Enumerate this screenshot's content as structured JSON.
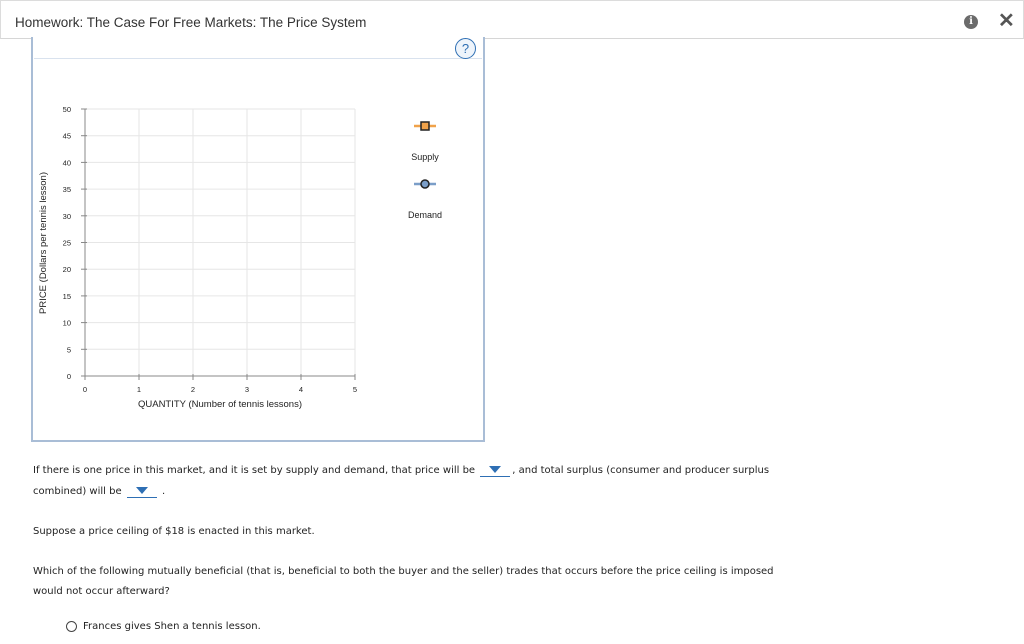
{
  "header": {
    "title": "Homework: The Case For Free Markets: The Price System",
    "info_icon": "i",
    "close_icon": "✕"
  },
  "help_icon": "?",
  "chart_data": {
    "type": "line",
    "xlabel": "QUANTITY (Number of tennis lessons)",
    "ylabel": "PRICE (Dollars per tennis lesson)",
    "x_ticks": [
      "0",
      "1",
      "2",
      "3",
      "4",
      "5"
    ],
    "y_ticks": [
      "0",
      "5",
      "10",
      "15",
      "20",
      "25",
      "30",
      "35",
      "40",
      "45",
      "50"
    ],
    "xlim": [
      0,
      5
    ],
    "ylim": [
      0,
      50
    ],
    "grid": true,
    "legend_placement": "right",
    "series": [
      {
        "name": "Supply",
        "color": "#f0a24a",
        "marker": "square",
        "values": []
      },
      {
        "name": "Demand",
        "color": "#7b9ec8",
        "marker": "circle",
        "values": []
      }
    ]
  },
  "questions": {
    "q1_part1": "If there is one price in this market, and it is set by supply and demand, that price will be",
    "q1_part2": ", and total surplus (consumer and producer surplus",
    "q1_part3": "combined) will be",
    "q1_part4": ".",
    "ceiling": "Suppose a price ceiling of $18 is enacted in this market.",
    "q2_line1": "Which of the following mutually beneficial (that is, beneficial to both the buyer and the seller) trades that occurs before the price ceiling is imposed",
    "q2_line2": "would not occur afterward?",
    "option1": "Frances gives Shen a tennis lesson."
  }
}
